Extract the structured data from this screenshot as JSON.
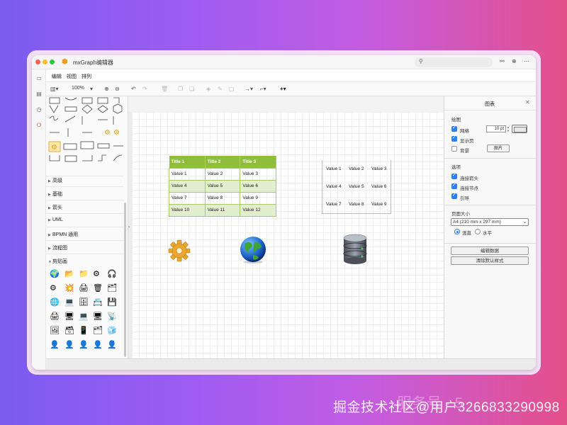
{
  "window": {
    "title": "mxGraph编辑器"
  },
  "menu": {
    "items": [
      "编辑",
      "视图",
      "排列"
    ]
  },
  "toolbar": {
    "zoom": "100%"
  },
  "sidebar": {
    "categories": [
      {
        "label": "高级",
        "open": false
      },
      {
        "label": "基础",
        "open": false
      },
      {
        "label": "箭头",
        "open": false
      },
      {
        "label": "UML",
        "open": false
      },
      {
        "label": "BPMN 通用",
        "open": false
      },
      {
        "label": "流程图",
        "open": false
      },
      {
        "label": "剪贴画",
        "open": true
      }
    ]
  },
  "canvas": {
    "table1": {
      "headers": [
        "Title 1",
        "Title 2",
        "Title 3"
      ],
      "rows": [
        [
          "Value 1",
          "Value 2",
          "Value 3"
        ],
        [
          "Value 4",
          "Value 5",
          "Value 6"
        ],
        [
          "Value 7",
          "Value 8",
          "Value 9"
        ],
        [
          "Value 10",
          "Value 11",
          "Value 12"
        ]
      ]
    },
    "table2": {
      "rows": [
        [
          "Value 1",
          "Value 2",
          "Value 3"
        ],
        [
          "Value 4",
          "Value 5",
          "Value 6"
        ],
        [
          "Value 7",
          "Value 8",
          "Value 9"
        ]
      ]
    }
  },
  "panel": {
    "title": "图表",
    "close": "✕",
    "drawing": {
      "title": "绘图",
      "grid_label": "网格",
      "grid_size": "10 pt",
      "pageview_label": "显示页",
      "background_label": "背景",
      "image_button": "图片"
    },
    "options": {
      "title": "选项",
      "connection_arrows": "连接箭头",
      "connection_points": "连接节点",
      "guides": "引导"
    },
    "page_size": {
      "title": "页面大小",
      "selected": "A4 (210 mm x 297 mm)",
      "portrait": "竖直",
      "landscape": "水平"
    },
    "edit_data_button": "编辑数据",
    "clear_default_style_button": "清除默认样式"
  },
  "watermark": {
    "text": "掘金技术社区@用户3266833290998",
    "faded_text": "服务号 · 5"
  },
  "colors": {
    "table_header": "#8fbf3a",
    "table_alt_row": "#e2efcf",
    "checkbox_on": "#2f7ef5"
  }
}
